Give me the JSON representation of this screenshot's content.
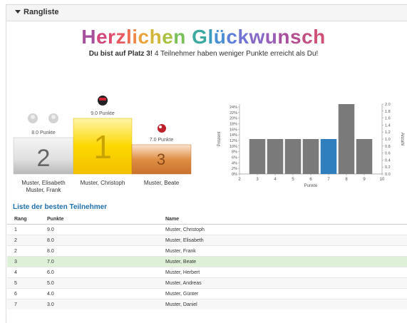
{
  "panel": {
    "title": "Rangliste"
  },
  "headline": {
    "title": "Herzlichen Glückwunsch",
    "letter_colors": [
      "#a7509e",
      "#d2487e",
      "#e0496d",
      "#e75860",
      "#ec6e55",
      "#ee8a49",
      "#e9a43f",
      "#d3b73d",
      "#a9c142",
      "#79c05a",
      "#4eb67e",
      "#3caaa0",
      "#3c9cbf",
      "#4a8ed4",
      "#5e80d9",
      "#7274d3",
      "#8669c7",
      "#9a5fb8",
      "#a7509e",
      "#b55090",
      "#c35082",
      "#d04f74"
    ],
    "sub_bold": "Du bist auf Platz 3!",
    "sub_rest": " 4 Teilnehmer haben weniger Punkte erreicht als Du!"
  },
  "podium": {
    "first": {
      "rank": "1",
      "points_label": "9.0 Punkte",
      "names": [
        "Muster, Christoph"
      ],
      "color": "#fcd200"
    },
    "second": {
      "rank": "2",
      "points_label": "8.0 Punkte",
      "names": [
        "Muster, Elisabeth",
        "Muster, Frank"
      ],
      "color": "#d8d8d8"
    },
    "third": {
      "rank": "3",
      "points_label": "7.0 Punkte",
      "names": [
        "Muster, Beate"
      ],
      "color": "#d98a3e"
    }
  },
  "chart_data": {
    "type": "bar",
    "x": [
      3,
      4,
      5,
      6,
      7,
      8,
      9
    ],
    "values": [
      12.5,
      12.5,
      12.5,
      12.5,
      12.5,
      25,
      12.5
    ],
    "highlight_x": 7,
    "xlim": [
      2,
      10
    ],
    "xticks": [
      "2",
      "3",
      "4",
      "5",
      "6",
      "7",
      "8",
      "9",
      "10"
    ],
    "xlabel": "Punkte",
    "ylabel": "Prozent",
    "ylabel_right": "Anzahl",
    "ylim": [
      0,
      25
    ],
    "yticks_left": [
      "0%",
      "2%",
      "4%",
      "6%",
      "8%",
      "10%",
      "12%",
      "14%",
      "16%",
      "18%",
      "20%",
      "22%",
      "24%"
    ],
    "yticks_right": [
      "0.0",
      "0.2",
      "0.4",
      "0.6",
      "0.8",
      "1.0",
      "1.2",
      "1.4",
      "1.6",
      "1.8",
      "2.0"
    ],
    "bar_color": "#7a7a7a",
    "highlight_color": "#2f7fbf"
  },
  "list": {
    "title": "Liste der besten Teilnehmer",
    "headers": [
      "Rang",
      "Punkte",
      "Name"
    ],
    "rows": [
      [
        "1",
        "9.0",
        "Muster, Christoph"
      ],
      [
        "2",
        "8.0",
        "Muster, Elisabeth"
      ],
      [
        "2",
        "8.0",
        "Muster, Frank"
      ],
      [
        "3",
        "7.0",
        "Muster, Beate"
      ],
      [
        "4",
        "6.0",
        "Muster, Herbert"
      ],
      [
        "5",
        "5.0",
        "Muster, Andreas"
      ],
      [
        "6",
        "4.0",
        "Muster, Günter"
      ],
      [
        "7",
        "3.0",
        "Muster, Daniel"
      ]
    ],
    "highlight_row": 3
  }
}
